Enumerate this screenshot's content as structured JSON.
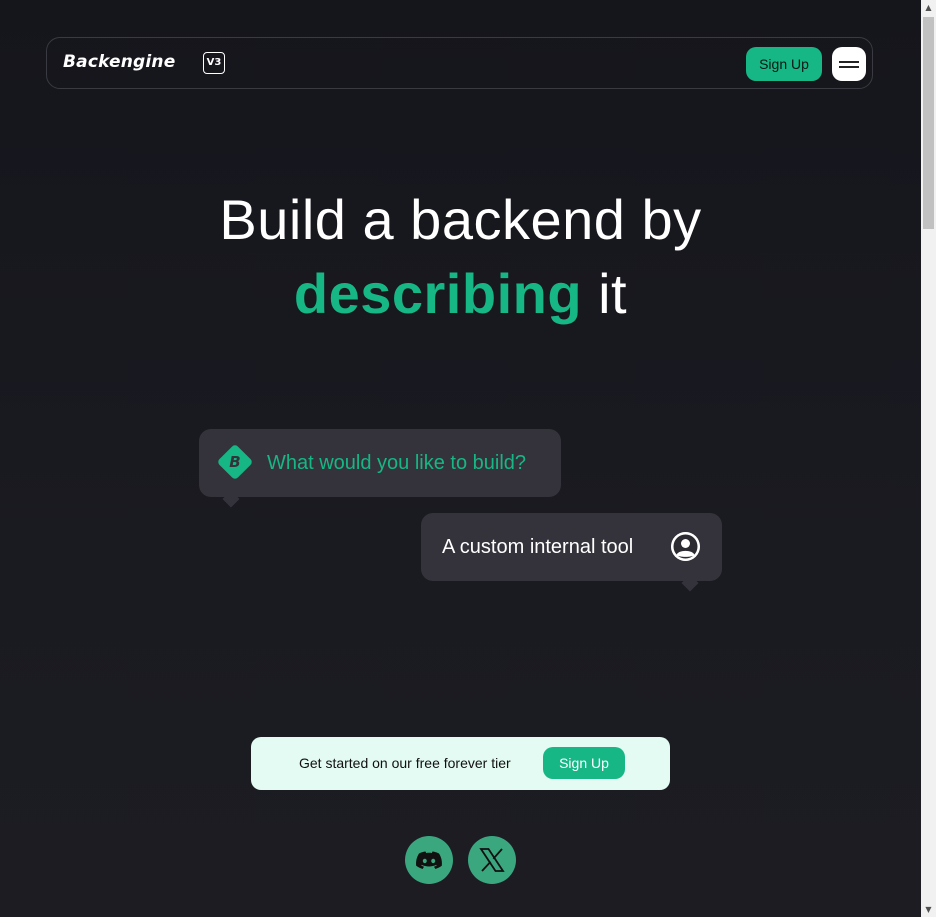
{
  "colors": {
    "accent": "#16b785",
    "background": "#17161d",
    "bubble": "#34333b",
    "cta_background": "#e3fbf2"
  },
  "navbar": {
    "logo": "Backengine",
    "version": "V3",
    "signup_label": "Sign Up",
    "menu_icon": "hamburger-icon"
  },
  "hero": {
    "line1": "Build a backend by",
    "accent_word": "describing",
    "line2_rest": " it"
  },
  "chat": {
    "assistant_icon": "backengine-logo-icon",
    "assistant_message": "What would you like to build?",
    "user_message": "A custom internal tool",
    "user_icon": "user-avatar-icon"
  },
  "cta": {
    "text": "Get started on our free forever tier",
    "button_label": "Sign Up"
  },
  "social": {
    "discord_icon": "discord-icon",
    "x_icon": "x-icon"
  }
}
